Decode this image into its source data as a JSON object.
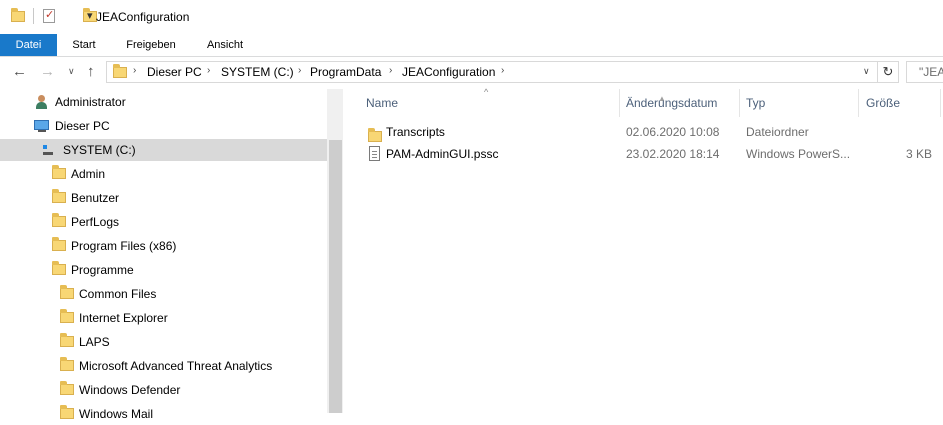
{
  "window": {
    "title": "JEAConfiguration"
  },
  "quick_access": {
    "items": [
      "folder-icon",
      "properties-icon",
      "new-folder-icon",
      "customize-dropdown-icon"
    ]
  },
  "ribbon": {
    "tabs": [
      "Datei",
      "Start",
      "Freigeben",
      "Ansicht"
    ],
    "active": "Datei",
    "active_color": "#1979ca"
  },
  "address": {
    "breadcrumbs": [
      "Dieser PC",
      "SYSTEM (C:)",
      "ProgramData",
      "JEAConfiguration"
    ],
    "search_placeholder": "\"JEA"
  },
  "nav_pane": {
    "items": [
      {
        "label": "Administrator",
        "icon": "user-icon",
        "level": 0
      },
      {
        "label": "Dieser PC",
        "icon": "computer-icon",
        "level": 0
      },
      {
        "label": "SYSTEM (C:)",
        "icon": "drive-icon",
        "level": 1,
        "selected": true
      },
      {
        "label": "Admin",
        "icon": "folder-icon",
        "level": 2
      },
      {
        "label": "Benutzer",
        "icon": "folder-icon",
        "level": 2
      },
      {
        "label": "PerfLogs",
        "icon": "folder-icon",
        "level": 2
      },
      {
        "label": "Program Files (x86)",
        "icon": "folder-icon",
        "level": 2
      },
      {
        "label": "Programme",
        "icon": "folder-icon",
        "level": 2
      },
      {
        "label": "Common Files",
        "icon": "folder-icon",
        "level": 3
      },
      {
        "label": "Internet Explorer",
        "icon": "folder-icon",
        "level": 3
      },
      {
        "label": "LAPS",
        "icon": "folder-icon",
        "level": 3
      },
      {
        "label": "Microsoft Advanced Threat Analytics",
        "icon": "folder-icon",
        "level": 3
      },
      {
        "label": "Windows Defender",
        "icon": "folder-icon",
        "level": 3
      },
      {
        "label": "Windows Mail",
        "icon": "folder-icon",
        "level": 3
      }
    ]
  },
  "file_list": {
    "columns": [
      "Name",
      "Änderungsdatum",
      "Typ",
      "Größe"
    ],
    "rows": [
      {
        "name": "Transcripts",
        "icon": "folder-icon",
        "modified": "02.06.2020 10:08",
        "type": "Dateiordner",
        "size": ""
      },
      {
        "name": "PAM-AdminGUI.pssc",
        "icon": "file-icon",
        "modified": "23.02.2020 18:14",
        "type": "Windows PowerS...",
        "size": "3 KB"
      }
    ]
  }
}
